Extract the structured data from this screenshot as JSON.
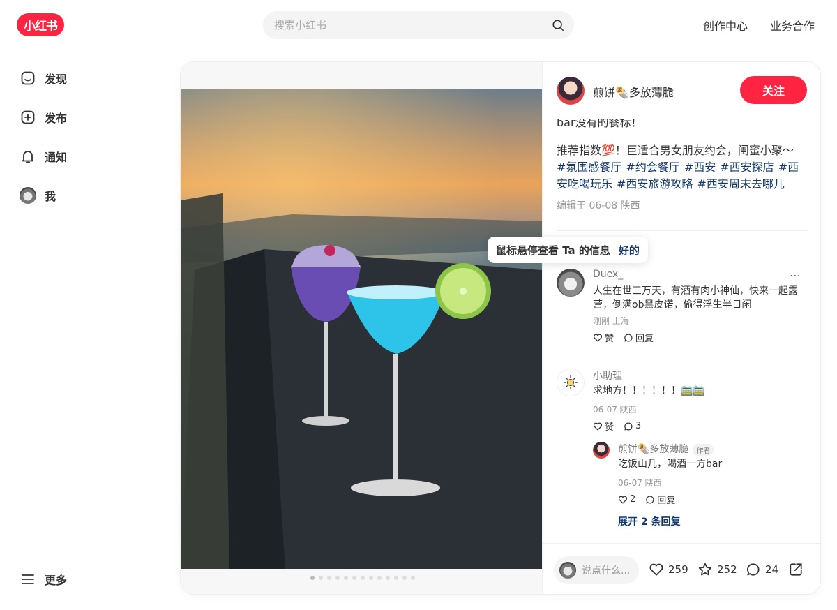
{
  "header": {
    "logo_text": "小红书",
    "search_placeholder": "搜索小红书",
    "links": [
      "创作中心",
      "业务合作"
    ]
  },
  "sidebar": {
    "items": [
      {
        "label": "发现",
        "icon": "home-icon"
      },
      {
        "label": "发布",
        "icon": "plus-icon"
      },
      {
        "label": "通知",
        "icon": "bell-icon"
      },
      {
        "label": "我",
        "icon": "avatar"
      }
    ],
    "more_label": "更多"
  },
  "note": {
    "author_name": "煎饼🌯多放薄脆",
    "follow_label": "关注",
    "desc_tail": "bar没有的餐标！",
    "desc": "推荐指数💯！巨适合男女朋友约会，闺蜜小聚～",
    "tags": [
      "#氛围感餐厅",
      "#约会餐厅",
      "#西安",
      "#西安探店",
      "#西安吃喝玩乐",
      "#西安旅游攻略",
      "#西安周末去哪儿"
    ],
    "edit_meta": "编辑于 06-08 陕西",
    "image_dots": 13
  },
  "tooltip": {
    "text": "鼠标悬停查看 Ta 的信息",
    "ok": "好的"
  },
  "comments": [
    {
      "name": "Duex_",
      "text": "人生在世三万天，有酒有肉小神仙，快来一起露营，倒满ob黑皮诺，偷得浮生半日闲",
      "meta": "刚刚 上海",
      "like_label": "赞",
      "reply_label": "回复"
    },
    {
      "name": "小助理",
      "text": "求地方！！！！！！🚞🚞",
      "meta": "06-07 陕西",
      "like_label": "赞",
      "reply_count": "3"
    }
  ],
  "reply": {
    "name": "煎饼🌯多放薄脆",
    "author_tag": "作者",
    "text": "吃饭山几，喝酒一方bar",
    "meta": "06-07 陕西",
    "like_count": "2",
    "reply_label": "回复"
  },
  "expand_label": "展开 2 条回复",
  "bottom": {
    "input_placeholder": "说点什么...",
    "likes": "259",
    "collects": "252",
    "comments": "24"
  },
  "colors": {
    "brand": "#ff2442",
    "tag": "#13386c"
  }
}
